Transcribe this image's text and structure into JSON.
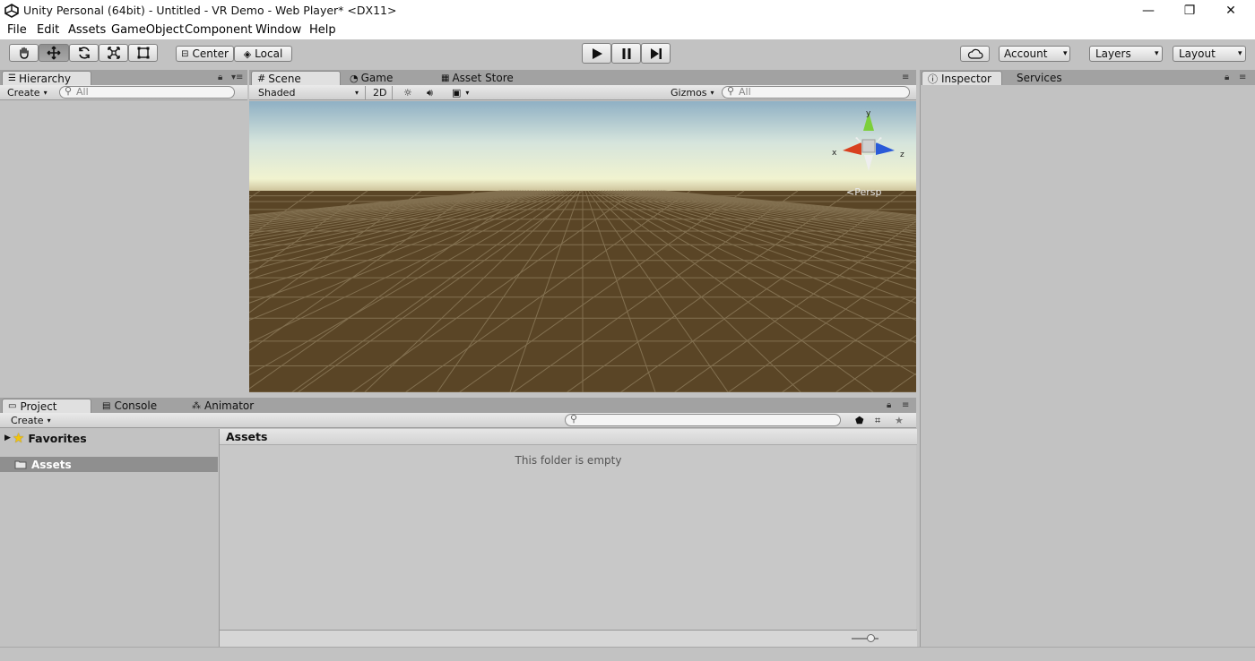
{
  "window": {
    "title": "Unity Personal (64bit) - Untitled - VR Demo - Web Player* <DX11>",
    "minimize": "—",
    "restore": "❐",
    "close": "✕"
  },
  "menu": [
    "File",
    "Edit",
    "Assets",
    "GameObject",
    "Component",
    "Window",
    "Help"
  ],
  "toolbar": {
    "tools": [
      "hand",
      "move",
      "rotate",
      "scale",
      "rect"
    ],
    "pivot": "Center",
    "space": "Local",
    "account": "Account",
    "layers": "Layers",
    "layout": "Layout"
  },
  "hierarchy": {
    "tab": "Hierarchy",
    "create": "Create",
    "search_placeholder": "All"
  },
  "scene": {
    "tabs": [
      "Scene",
      "Game",
      "Asset Store"
    ],
    "shading": "Shaded",
    "mode2d": "2D",
    "gizmos": "Gizmos",
    "search_placeholder": "All",
    "gizmo": {
      "x": "x",
      "y": "y",
      "z": "z",
      "view": "Persp"
    },
    "colors": {
      "sky_top": "#8fb0c4",
      "horizon": "#f1f3d0",
      "ground": "#5a4526"
    }
  },
  "inspector": {
    "tabs": [
      "Inspector",
      "Services"
    ]
  },
  "project": {
    "tabs": [
      "Project",
      "Console",
      "Animator"
    ],
    "create": "Create",
    "favorites": "Favorites",
    "assets": "Assets",
    "breadcrumb": "Assets",
    "empty_msg": "This folder is empty"
  }
}
